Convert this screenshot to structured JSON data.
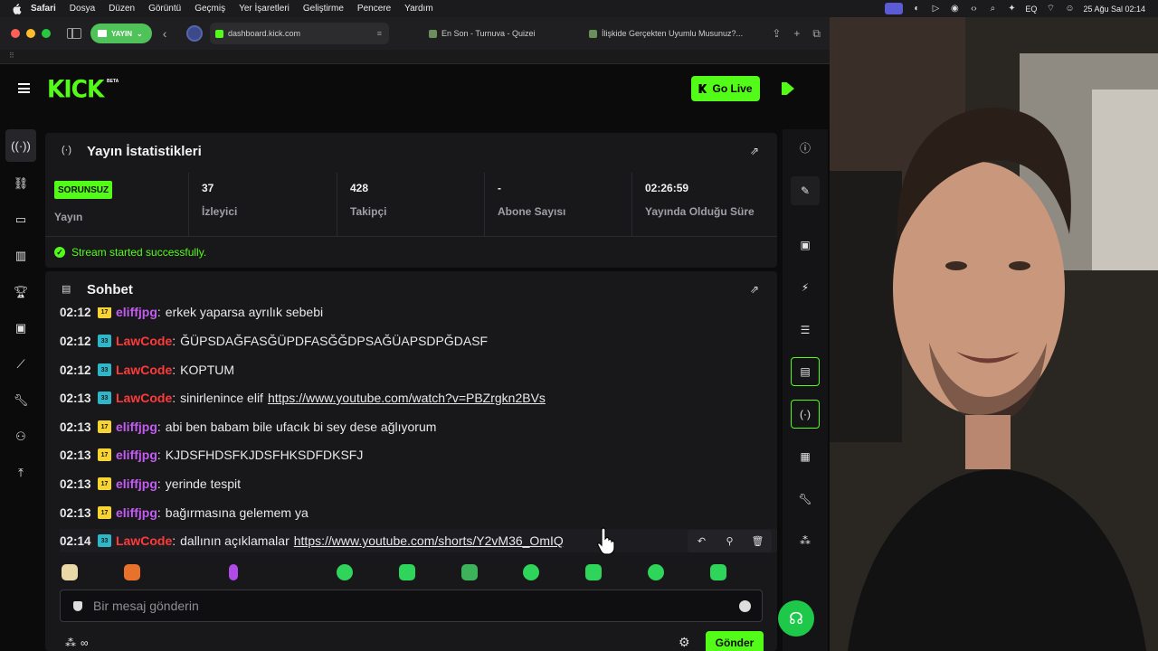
{
  "menubar": {
    "app": "Safari",
    "items": [
      "Dosya",
      "Düzen",
      "Görüntü",
      "Geçmiş",
      "Yer İşaretleri",
      "Geliştirme",
      "Pencere",
      "Yardım"
    ],
    "eq_label": "EQ",
    "datetime": "25 Ağu Sal  02:14"
  },
  "browser": {
    "profile_label": "YAYIN",
    "tabs": [
      {
        "title": "dashboard.kick.com",
        "favicon_color": "#53fc18",
        "active": true
      },
      {
        "title": "En Son - Turnuva - Quizei",
        "favicon_color": "#6a8f5a",
        "active": false
      },
      {
        "title": "İlişkide Gerçekten Uyumlu Musunuz?...",
        "favicon_color": "#6a8f5a",
        "active": false
      }
    ]
  },
  "kick": {
    "logo": "KICK",
    "beta": "BETA",
    "go_live_label": "Go Live",
    "accent_color": "#53fc18"
  },
  "stats_panel": {
    "title": "Yayın İstatistikleri",
    "status_badge": "SORUNSUZ",
    "status_label": "Yayın",
    "items": [
      {
        "value": "37",
        "label": "İzleyici"
      },
      {
        "value": "428",
        "label": "Takipçi"
      },
      {
        "value": "-",
        "label": "Abone Sayısı"
      },
      {
        "value": "02:26:59",
        "label": "Yayında Olduğu Süre"
      }
    ],
    "stream_message": "Stream started successfully."
  },
  "chat_panel": {
    "title": "Sohbet",
    "messages": [
      {
        "time": "02:12",
        "sub": "17",
        "user": "eliffjpg",
        "text": "erkek yaparsa ayrılık sebebi",
        "link": ""
      },
      {
        "time": "02:12",
        "sub": "33",
        "user": "LawCode",
        "text": "ĞÜPSDAĞFASĞÜPDFASĞĞDPSAĞÜAPSDPĞDASF",
        "link": ""
      },
      {
        "time": "02:12",
        "sub": "33",
        "user": "LawCode",
        "text": "KOPTUM",
        "link": ""
      },
      {
        "time": "02:13",
        "sub": "33",
        "user": "LawCode",
        "text": "sinirlenince elif",
        "link": "https://www.youtube.com/watch?v=PBZrgkn2BVs"
      },
      {
        "time": "02:13",
        "sub": "17",
        "user": "eliffjpg",
        "text": "abi ben babam bile ufacık bi sey dese ağlıyorum",
        "link": ""
      },
      {
        "time": "02:13",
        "sub": "17",
        "user": "eliffjpg",
        "text": "KJDSFHDSFKJDSFHKSDFDKSFJ",
        "link": ""
      },
      {
        "time": "02:13",
        "sub": "17",
        "user": "eliffjpg",
        "text": "yerinde tespit",
        "link": ""
      },
      {
        "time": "02:13",
        "sub": "17",
        "user": "eliffjpg",
        "text": "bağırmasına gelemem ya",
        "link": ""
      },
      {
        "time": "02:14",
        "sub": "33",
        "user": "LawCode",
        "text": "dallının açıklamalar",
        "link": "https://www.youtube.com/shorts/Y2vM36_OmIQ"
      }
    ],
    "input_placeholder": "Bir mesaj gönderin",
    "points_label": "∞",
    "send_label": "Gönder"
  }
}
